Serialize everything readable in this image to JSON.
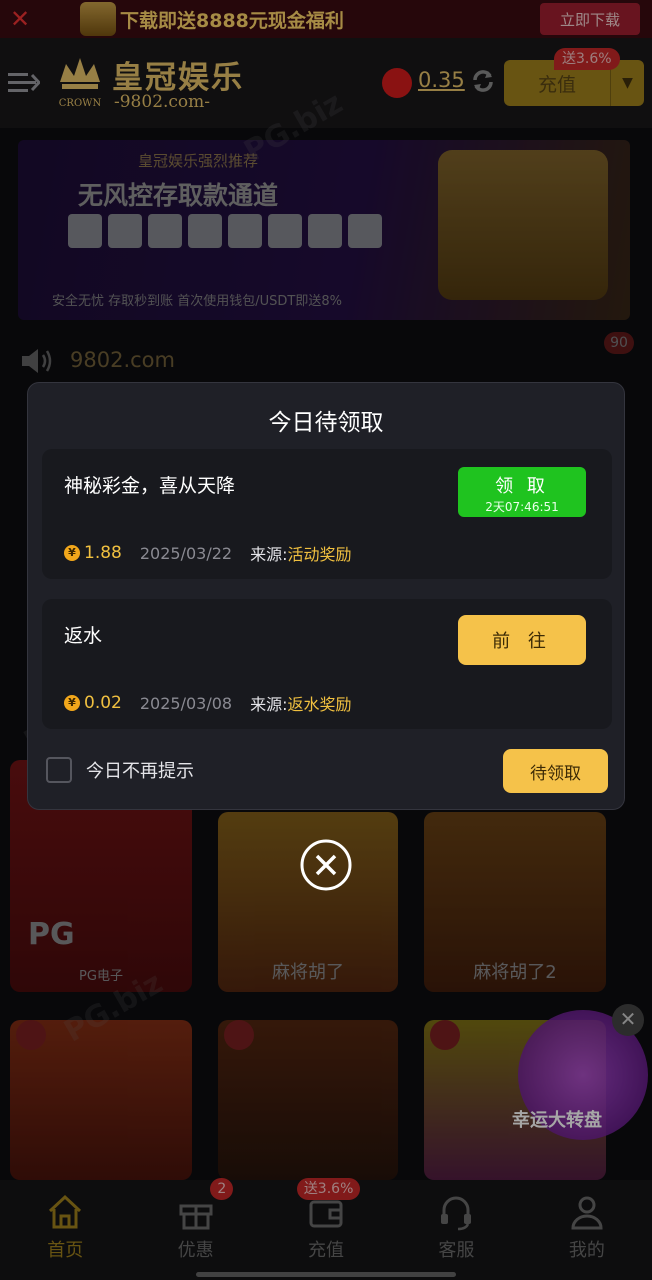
{
  "topbar": {
    "promo": "下载即送8888元现金福利",
    "download_label": "立即下载"
  },
  "header": {
    "brand": "皇冠娱乐",
    "brand_url": "-9802.com-",
    "crown_text": "CROWN",
    "balance": "0.35",
    "recharge_label": "充值",
    "recharge_bonus": "送3.6%"
  },
  "banner": {
    "subtitle": "皇冠娱乐强烈推荐",
    "title": "无风控存取款通道",
    "footer": "安全无忧 存取秒到账   首次使用钱包/USDT即送8%"
  },
  "announce": {
    "text": "9802.com",
    "badge": "90"
  },
  "games": [
    {
      "label": "PG电子"
    },
    {
      "label": "麻将胡了"
    },
    {
      "label": "麻将胡了2"
    }
  ],
  "wheel": {
    "label": "幸运大转盘"
  },
  "modal": {
    "title": "今日待领取",
    "items": [
      {
        "title": "神秘彩金，喜从天降",
        "amount": "1.88",
        "date": "2025/03/22",
        "source_label": "来源:",
        "source": "活动奖励",
        "button": "领 取",
        "countdown": "2天07:46:51"
      },
      {
        "title": "返水",
        "amount": "0.02",
        "date": "2025/03/08",
        "source_label": "来源:",
        "source": "返水奖励",
        "button": "前 往"
      }
    ],
    "dont_remind": "今日不再提示",
    "pending_button": "待领取"
  },
  "nav": {
    "items": [
      {
        "label": "首页"
      },
      {
        "label": "优惠",
        "badge": "2"
      },
      {
        "label": "充值",
        "badge": "送3.6%"
      },
      {
        "label": "客服"
      },
      {
        "label": "我的"
      }
    ]
  },
  "colors": {
    "gold": "#e9c46a",
    "claim_green": "#1fc31f",
    "button_yellow": "#f5c24a",
    "badge_red": "#c62828"
  },
  "watermark": "PG.biz"
}
